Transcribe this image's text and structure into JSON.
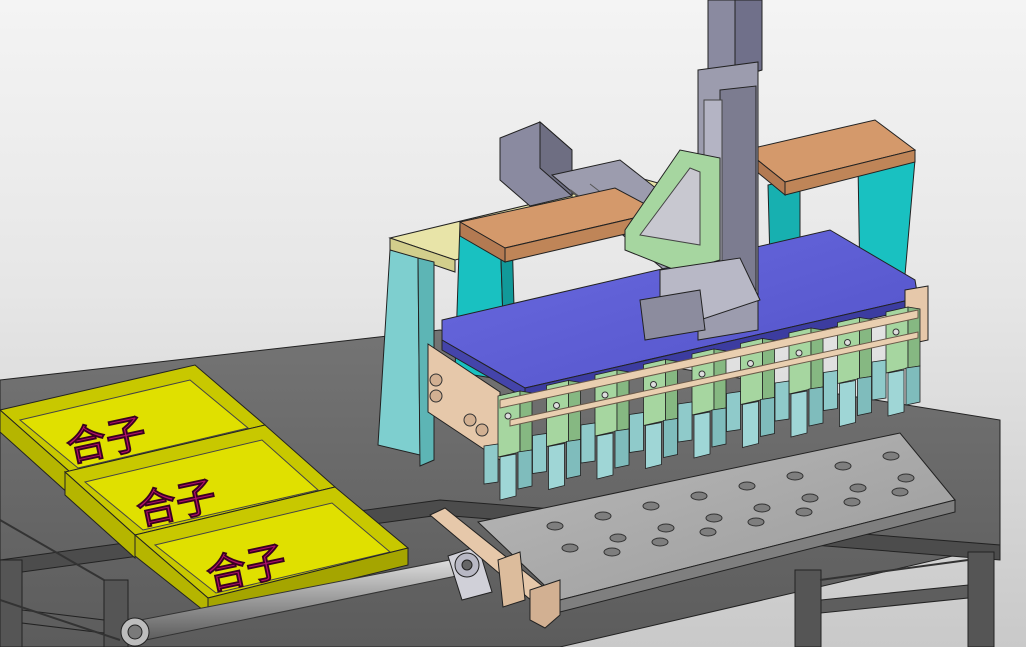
{
  "scene": {
    "background_top": "#f4f4f4",
    "background_bottom": "#c9c9c9",
    "colors": {
      "table_top": "#6e6e6e",
      "table_frame": "#5a5a5a",
      "tray": "#d6d600",
      "tray_label": "#b0106a",
      "beam_top": "#d4996b",
      "beam_side": "#b37a52",
      "leg_cyan": "#19c1c1",
      "leg_pale": "#7ecfcf",
      "side_rail": "#e8e4a8",
      "carriage_plate": "#6666dd",
      "actuator_metal": "#8a8a9a",
      "gripper_green": "#a6d6a0",
      "gripper_cyan": "#9fd6d6",
      "fixture_plate": "#a8a8a8",
      "end_block": "#e6c8aa"
    }
  },
  "trays": [
    {
      "label": "合子"
    },
    {
      "label": "合子"
    },
    {
      "label": "合子"
    }
  ],
  "gripper_count": 9,
  "fixture_plate": {
    "rows": 3,
    "holes_per_row": 8
  }
}
